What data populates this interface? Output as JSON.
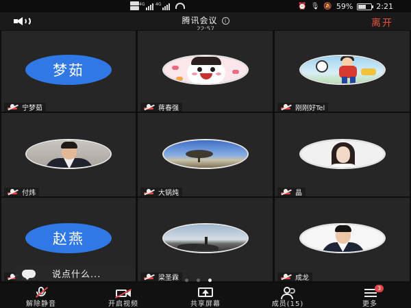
{
  "status_bar": {
    "sim1": "1",
    "sim2": "2",
    "network1": "4G",
    "network2": "4G",
    "battery": "59%",
    "battery_level": 0.59,
    "time": "2:21"
  },
  "header": {
    "title": "腾讯会议",
    "info": "i",
    "timer": "22:57",
    "leave": "离开"
  },
  "participants": [
    {
      "name": "宁梦茹",
      "avatar_text": "梦茹",
      "avatar_color": "#2f78e5"
    },
    {
      "name": "蒋春强",
      "avatar_art": "cartoon"
    },
    {
      "name": "刚刚好Tel",
      "avatar_art": "soccer"
    },
    {
      "name": "付炜",
      "avatar_art": "portrait-man"
    },
    {
      "name": "大锅炖",
      "avatar_art": "tree-landscape"
    },
    {
      "name": "晶",
      "avatar_art": "portrait-woman"
    },
    {
      "name": "赵燕",
      "avatar_text": "赵燕",
      "avatar_color": "#2f78e5"
    },
    {
      "name": "梁圣霖",
      "avatar_art": "sky-landscape"
    },
    {
      "name": "成龙",
      "avatar_art": "portrait-man-white"
    }
  ],
  "chat": {
    "placeholder": "说点什么..."
  },
  "pagination": {
    "pages": 3,
    "current": 3
  },
  "toolbar": {
    "unmute": "解除静音",
    "start_video": "开启视频",
    "share_screen": "共享屏幕",
    "members": "成员(15)",
    "more": "更多",
    "more_badge": "3"
  },
  "colors": {
    "leave": "#e5533d",
    "accent_blue": "#2f78e5",
    "mute_red": "#e04646"
  }
}
